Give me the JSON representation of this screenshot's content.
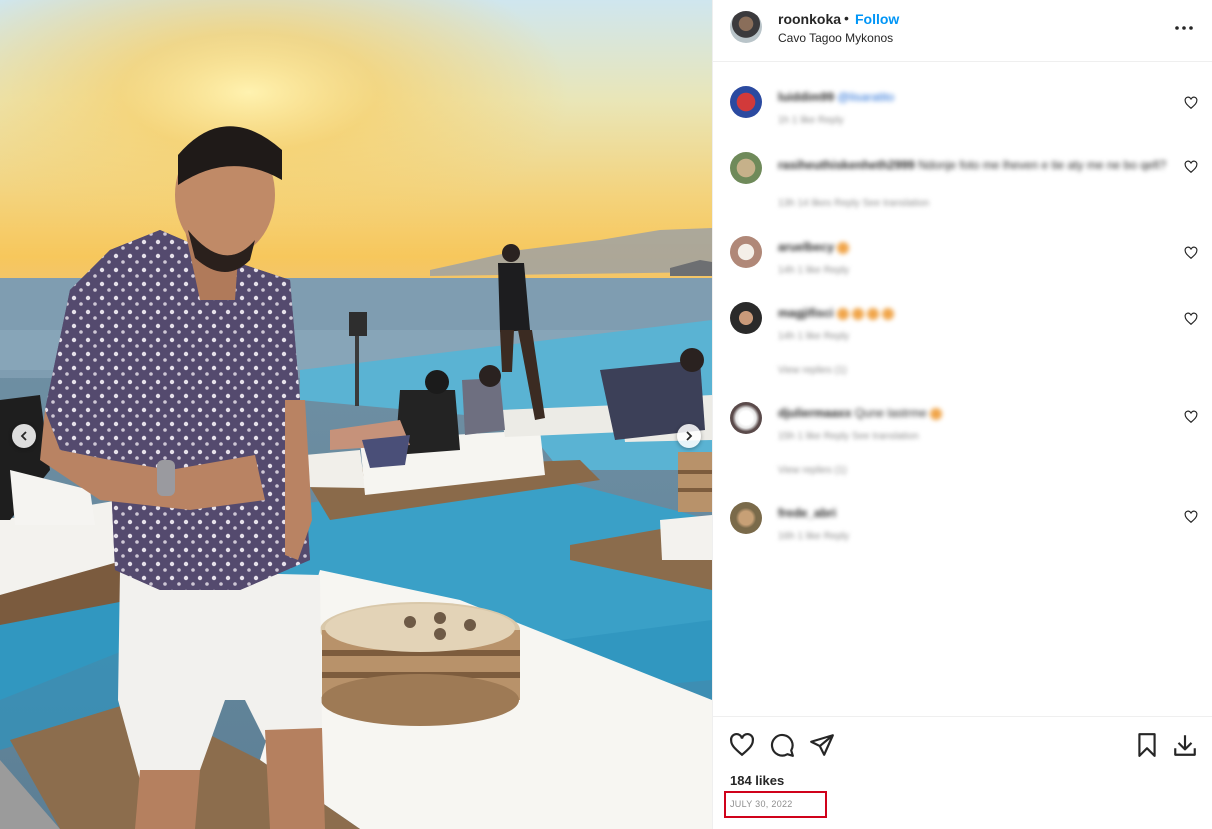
{
  "post": {
    "username": "roonkoka",
    "separator": "•",
    "follow_label": "Follow",
    "location": "Cavo Tagoo Mykonos",
    "likes": "184 likes",
    "date": "JULY 30, 2022"
  },
  "comments": [
    {
      "user": "luiddim99",
      "text": "@lisaratito",
      "meta": "1h   1 like   Reply"
    },
    {
      "user": "rasiheuthiskenheth2999",
      "text": "Ndonje foto me lheven e tie aty me ne bo qefi?",
      "meta": "13h   14 likes   Reply   See translation"
    },
    {
      "user": "aruelbecy",
      "text": "",
      "meta": "14h   1 like   Reply"
    },
    {
      "user": "magjifisci",
      "text": "",
      "meta": "14h   1 like   Reply",
      "replies": "View replies (1)"
    },
    {
      "user": "djuliermaaxx",
      "text": "Qune lastrme",
      "meta": "15h   1 like   Reply   See translation",
      "replies": "View replies (1)"
    },
    {
      "user": "frede_abri",
      "text": "",
      "meta": "16h   1 like   Reply"
    }
  ],
  "icons": {
    "more": "more-horizontal-icon",
    "like": "heart-icon",
    "comment": "comment-icon",
    "share": "send-icon",
    "save": "bookmark-icon",
    "download": "download-icon",
    "prev": "chevron-left-icon",
    "next": "chevron-right-icon"
  },
  "colors": {
    "follow": "#0095f6",
    "highlight_box": "#d0021b"
  }
}
